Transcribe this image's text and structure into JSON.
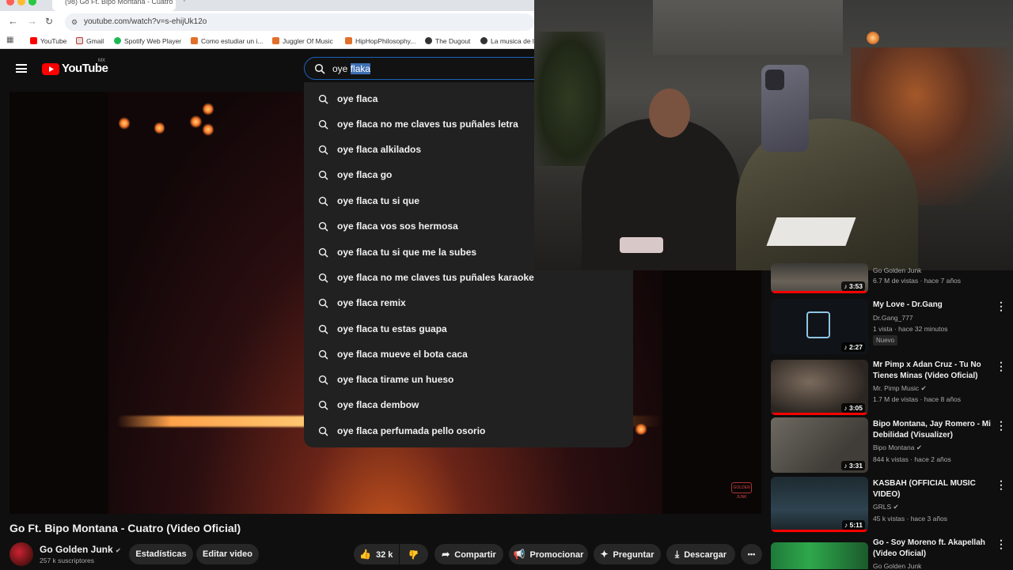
{
  "browser": {
    "tab_title": "(98) Go Ft. Bipo Montana - Cuatro",
    "url": "youtube.com/watch?v=s-ehijUk12o",
    "bookmarks": [
      {
        "label": "YouTube",
        "color": "#ff0000"
      },
      {
        "label": "Gmail",
        "color": "#888888"
      },
      {
        "label": "Spotify Web Player",
        "color": "#1db954"
      },
      {
        "label": "Como estudiar un i...",
        "color": "#e2702a"
      },
      {
        "label": "Juggler Of Music",
        "color": "#e2702a"
      },
      {
        "label": "HipHopPhilosophy...",
        "color": "#e2702a"
      },
      {
        "label": "The Dugout",
        "color": "#333333"
      },
      {
        "label": "La musica de l...",
        "color": "#333333"
      }
    ]
  },
  "header": {
    "logo": "YouTube",
    "region": "MX",
    "search_typed": "oye ",
    "search_selected": "flaka"
  },
  "suggestions": [
    "oye flaca",
    "oye flaca no me claves tus puñales letra",
    "oye flaca alkilados",
    "oye flaca go",
    "oye flaca tu si que",
    "oye flaca vos sos hermosa",
    "oye flaca tu si que me la subes",
    "oye flaca no me claves tus puñales karaoke",
    "oye flaca remix",
    "oye flaca tu estas guapa",
    "oye flaca mueve el bota caca",
    "oye flaca tirame un hueso",
    "oye flaca dembow",
    "oye flaca perfumada pello osorio"
  ],
  "video": {
    "title": "Go Ft. Bipo Montana - Cuatro (Video Oficial)",
    "channel": "Go Golden Junk",
    "subscribers": "257 k suscriptores",
    "watermark": "GOLDEN JUNK"
  },
  "actions": {
    "stats": "Estadísticas",
    "edit": "Editar video",
    "likes": "32 k",
    "share": "Compartir",
    "promote": "Promocionar",
    "ask": "Preguntar",
    "download": "Descargar",
    "more": "•••"
  },
  "sidebar": [
    {
      "title": "",
      "channel": "Go Golden Junk",
      "meta": "6.7 M de vistas · hace 7 años",
      "duration": "3:53",
      "progress": 1.0,
      "badge": ""
    },
    {
      "title": "My Love - Dr.Gang",
      "channel": "Dr.Gang_777",
      "meta": "1 vista · hace 32 minutos",
      "duration": "2:27",
      "progress": 0,
      "badge": "Nuevo"
    },
    {
      "title": "Mr Pimp x Adan Cruz  - Tu No Tienes Minas (Video Oficial)",
      "channel": "Mr. Pimp Music",
      "meta": "1.7 M de vistas · hace 8 años",
      "duration": "3:05",
      "progress": 1.0,
      "badge": ""
    },
    {
      "title": "Bipo Montana, Jay Romero - Mi Debilidad (Visualizer)",
      "channel": "Bipo Montana",
      "meta": "844 k vistas · hace 2 años",
      "duration": "3:31",
      "progress": 0,
      "badge": ""
    },
    {
      "title": "KASBAH (OFFICIAL MUSIC VIDEO)",
      "channel": "GRLS",
      "meta": "45 k vistas · hace 3 años",
      "duration": "5:11",
      "progress": 1.0,
      "badge": ""
    },
    {
      "title": "Go - Soy Moreno ft. Akapellah (Video Oficial)",
      "channel": "Go Golden Junk",
      "meta": "",
      "duration": "",
      "progress": 0,
      "badge": ""
    }
  ]
}
